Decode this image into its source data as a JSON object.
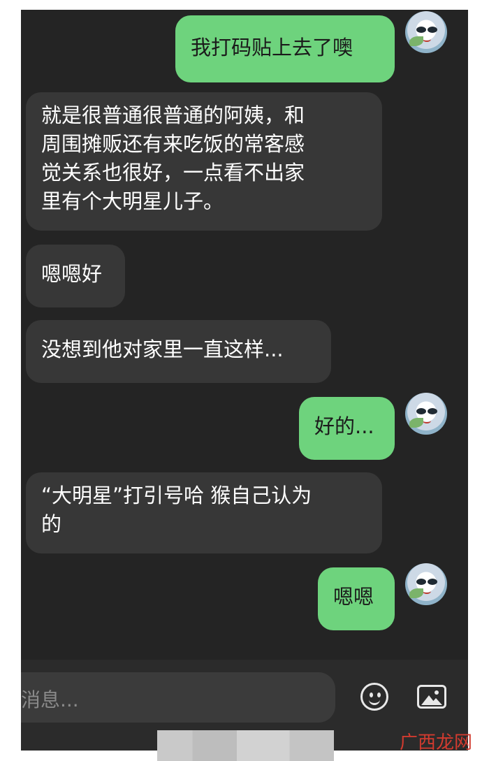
{
  "messages": [
    {
      "side": "out",
      "text": "我打码贴上去了噢"
    },
    {
      "side": "in",
      "text": "就是很普通很普通的阿姨，和\n周围摊贩还有来吃饭的常客感\n觉关系也很好，一点看不出家\n里有个大明星儿子。"
    },
    {
      "side": "in",
      "text": "嗯嗯好"
    },
    {
      "side": "in",
      "text": "没想到他对家里一直这样..."
    },
    {
      "side": "out",
      "text": "好的..."
    },
    {
      "side": "in",
      "text": "“大明星”打引号哈 猴自己认为\n的"
    },
    {
      "side": "out",
      "text": "嗯嗯"
    }
  ],
  "input": {
    "placeholder": "消息..."
  },
  "icons": {
    "emoji": "smiley-icon",
    "image": "image-icon",
    "avatar": "avatar-icon"
  },
  "colors": {
    "outgoing_bubble": "#6ed37d",
    "incoming_bubble": "#373737",
    "background": "#242424"
  },
  "watermark": "广西龙网"
}
